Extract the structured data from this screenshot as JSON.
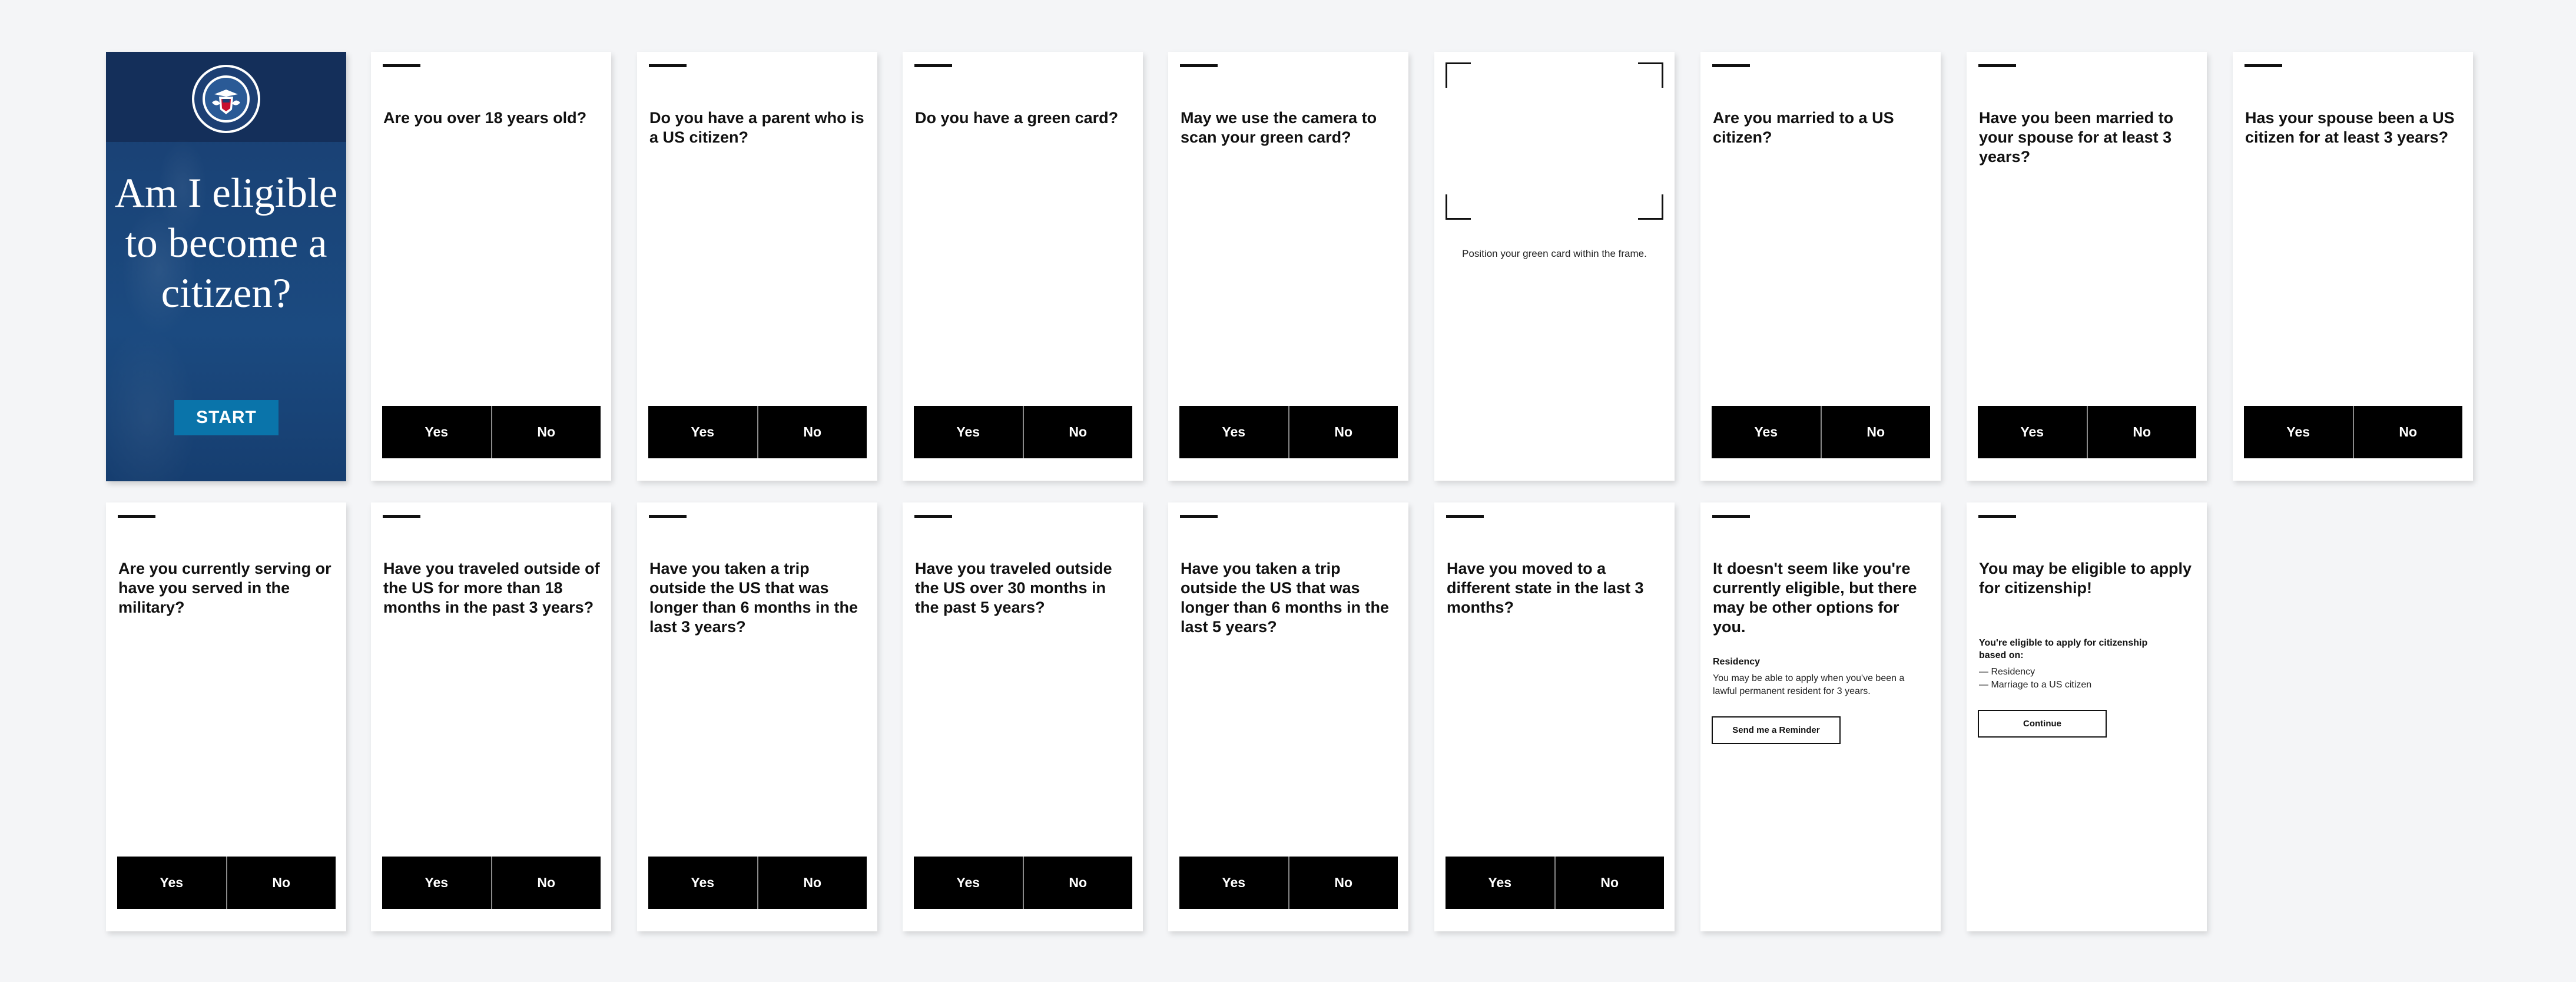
{
  "landing": {
    "title": "Am I eligible to become a citizen?",
    "start_label": "START",
    "brand_color": "#1b4a80",
    "accent_color": "#0a74aa"
  },
  "answer_labels": {
    "yes": "Yes",
    "no": "No"
  },
  "questions": [
    "Are you over 18 years old?",
    "Do you have a parent who is a US citizen?",
    "Do you have a green card?",
    "May we use the camera to scan your green card?",
    "Are you married to a US citizen?",
    "Have you been married to your spouse for at least 3 years?",
    "Has your spouse been a US citizen for at least 3 years?",
    "Are you currently serving or have you served in the military?",
    "Have you traveled outside of the US for more than 18 months in the past 3 years?",
    "Have you taken a trip outside the US that was longer than 6 months in the last 3 years?",
    "Have you traveled outside the US over 30 months in the past 5 years?",
    "Have you taken a trip outside the US that was longer than 6 months in the last 5 years?",
    "Have you moved to a different state in the last 3 months?"
  ],
  "scanner": {
    "caption": "Position your green card within the frame."
  },
  "not_eligible": {
    "heading": "It doesn't seem like you're currently eligible, but there may be other options for you.",
    "section_title": "Residency",
    "section_text": "You may be able to apply when you've been a lawful permanent resident for 3 years.",
    "button_label": "Send me a Reminder"
  },
  "eligible": {
    "heading": "You may be eligible to apply for citizenship!",
    "basis_label": "You're eligible to apply for citizenship based on:",
    "basis_items": [
      "— Residency",
      "— Marriage to a US citizen"
    ],
    "button_label": "Continue"
  }
}
